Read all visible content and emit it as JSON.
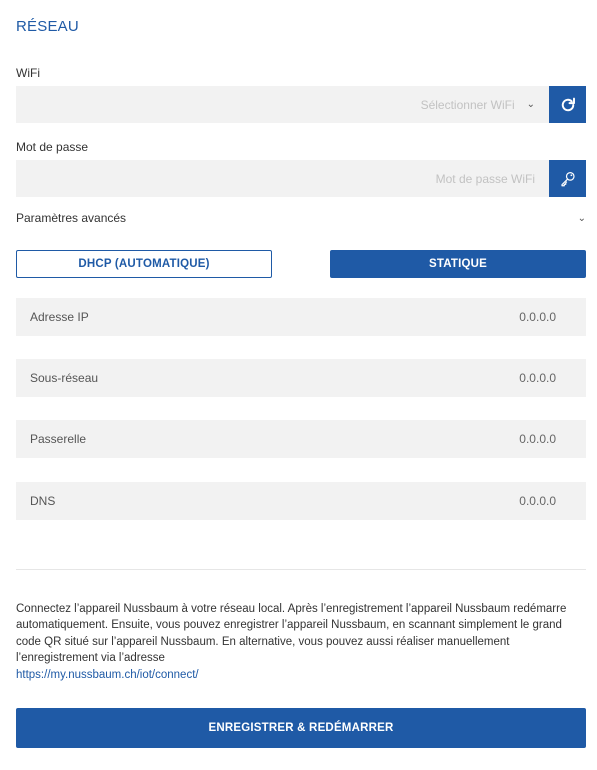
{
  "section": {
    "title": "RÉSEAU"
  },
  "wifi": {
    "label": "WiFi",
    "placeholder": "Sélectionner WiFi",
    "dropdown_icon": "chevron-down-icon",
    "refresh_icon": "refresh-icon"
  },
  "password": {
    "label": "Mot de passe",
    "placeholder": "Mot de passe WiFi",
    "key_icon": "key-icon"
  },
  "advanced": {
    "label": "Paramètres avancés",
    "icon": "chevron-down-icon"
  },
  "mode": {
    "dhcp_label": "DHCP (AUTOMATIQUE)",
    "static_label": "STATIQUE",
    "selected": "STATIQUE"
  },
  "network_fields": [
    {
      "label": "Adresse IP",
      "value": "0.0.0.0"
    },
    {
      "label": "Sous-réseau",
      "value": "0.0.0.0"
    },
    {
      "label": "Passerelle",
      "value": "0.0.0.0"
    },
    {
      "label": "DNS",
      "value": "0.0.0.0"
    }
  ],
  "description": {
    "text": "Connectez l’appareil Nussbaum à votre réseau local. Après l’enregistrement l’appareil Nussbaum redémarre automatiquement. Ensuite, vous pouvez enregistrer l’appareil Nussbaum, en scannant simplement le grand code QR situé sur l’appareil Nussbaum. En alternative, vous pouvez aussi réaliser manuellement l’enregistrement via l’adresse",
    "link": "https://my.nussbaum.ch/iot/connect/"
  },
  "submit": {
    "label": "ENREGISTRER & REDÉMARRER"
  },
  "colors": {
    "accent": "#1f5aa6",
    "field_bg": "#f2f2f2"
  }
}
